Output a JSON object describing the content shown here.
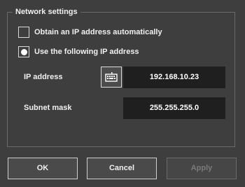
{
  "group": {
    "title": "Network settings"
  },
  "options": {
    "auto": {
      "label": "Obtain an IP address automatically",
      "checked": false
    },
    "manual": {
      "label": "Use the following IP address",
      "checked": true
    }
  },
  "fields": {
    "ip": {
      "label": "IP address",
      "value": "192.168.10.23"
    },
    "subnet": {
      "label": "Subnet mask",
      "value": "255.255.255.0"
    }
  },
  "buttons": {
    "ok": "OK",
    "cancel": "Cancel",
    "apply": "Apply"
  },
  "icons": {
    "keyboard": "keyboard-icon"
  },
  "colors": {
    "background": "#3e3e3e",
    "field_background": "#1f1f1f",
    "border": "#cfcfcf",
    "text": "#f0f0f0",
    "disabled_text": "#7a7a7a"
  }
}
